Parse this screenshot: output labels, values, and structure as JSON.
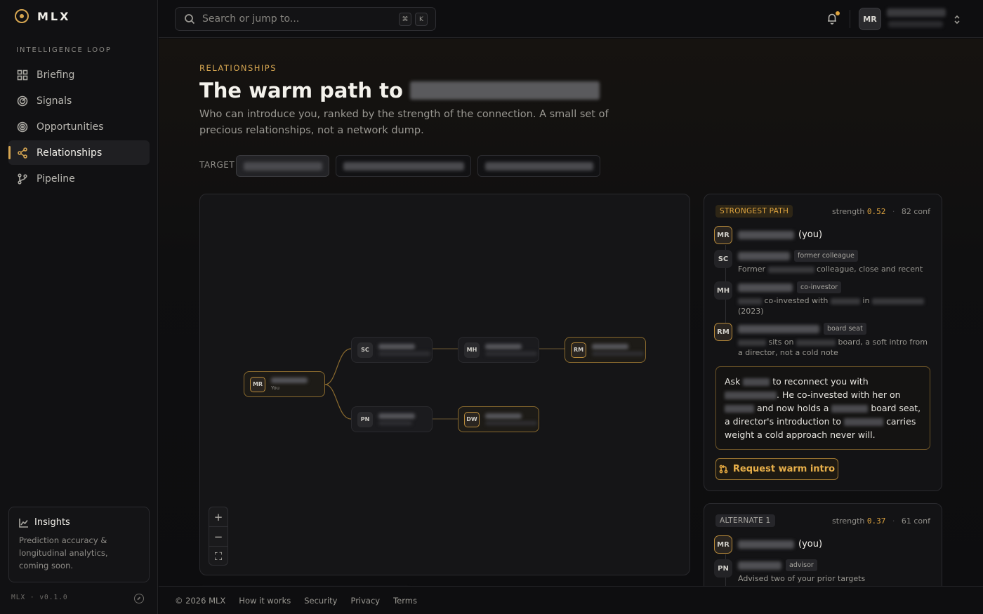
{
  "sidebar": {
    "brand": "MLX",
    "section_label": "INTELLIGENCE LOOP",
    "items": [
      {
        "label": "Briefing",
        "icon": "grid-icon"
      },
      {
        "label": "Signals",
        "icon": "radar-icon"
      },
      {
        "label": "Opportunities",
        "icon": "target-icon"
      },
      {
        "label": "Relationships",
        "icon": "share-nodes-icon",
        "active": true
      },
      {
        "label": "Pipeline",
        "icon": "branch-icon"
      }
    ],
    "insights": {
      "title": "Insights",
      "body": "Prediction accuracy & longitudinal analytics, coming soon."
    },
    "version": "MLX · v0.1.0"
  },
  "topbar": {
    "search_placeholder": "Search or jump to...",
    "shortcut_keys": [
      "⌘",
      "K"
    ],
    "user_initials": "MR"
  },
  "page": {
    "kicker": "RELATIONSHIPS",
    "title_prefix": "The warm path to",
    "subtitle": "Who can introduce you, ranked by the strength of the connection. A small set of precious relationships, not a network dump.",
    "target_label": "TARGET"
  },
  "graph": {
    "nodes": [
      {
        "initials": "MR",
        "sub": "You",
        "gold": true
      },
      {
        "initials": "SC",
        "gold": false
      },
      {
        "initials": "MH",
        "gold": false
      },
      {
        "initials": "RM",
        "gold": true
      },
      {
        "initials": "PN",
        "gold": false
      },
      {
        "initials": "DW",
        "gold": true
      }
    ],
    "zoom_in": "+",
    "zoom_out": "−",
    "fit": "⛶"
  },
  "strongest": {
    "pill": "STRONGEST PATH",
    "strength_label": "strength",
    "strength": "0.52",
    "conf": "82 conf",
    "you_suffix": "(you)",
    "steps": [
      {
        "initials": "MR"
      },
      {
        "initials": "SC",
        "tag": "former colleague",
        "desc_a": "Former",
        "desc_b": "colleague, close and recent"
      },
      {
        "initials": "MH",
        "tag": "co-investor",
        "desc_a": "co-invested with",
        "desc_b": "in",
        "desc_c": "(2023)"
      },
      {
        "initials": "RM",
        "tag": "board seat",
        "desc_a": "sits on",
        "desc_b": "board, a soft intro from a director, not a cold note"
      }
    ],
    "note": {
      "a": "Ask",
      "b": "to reconnect you with",
      "c": "He co-invested with her on",
      "d": "and now holds a",
      "e": "board seat, a director's introduction to",
      "f": "carries weight a cold approach never will."
    },
    "cta": "Request warm intro"
  },
  "alternate": {
    "pill": "ALTERNATE 1",
    "strength_label": "strength",
    "strength": "0.37",
    "conf": "61 conf",
    "you_suffix": "(you)",
    "steps": [
      {
        "initials": "MR"
      },
      {
        "initials": "PN",
        "tag": "advisor",
        "desc": "Advised two of your prior targets"
      }
    ]
  },
  "footer": {
    "copyright": "© 2026 MLX",
    "links": [
      "How it works",
      "Security",
      "Privacy",
      "Terms"
    ]
  }
}
